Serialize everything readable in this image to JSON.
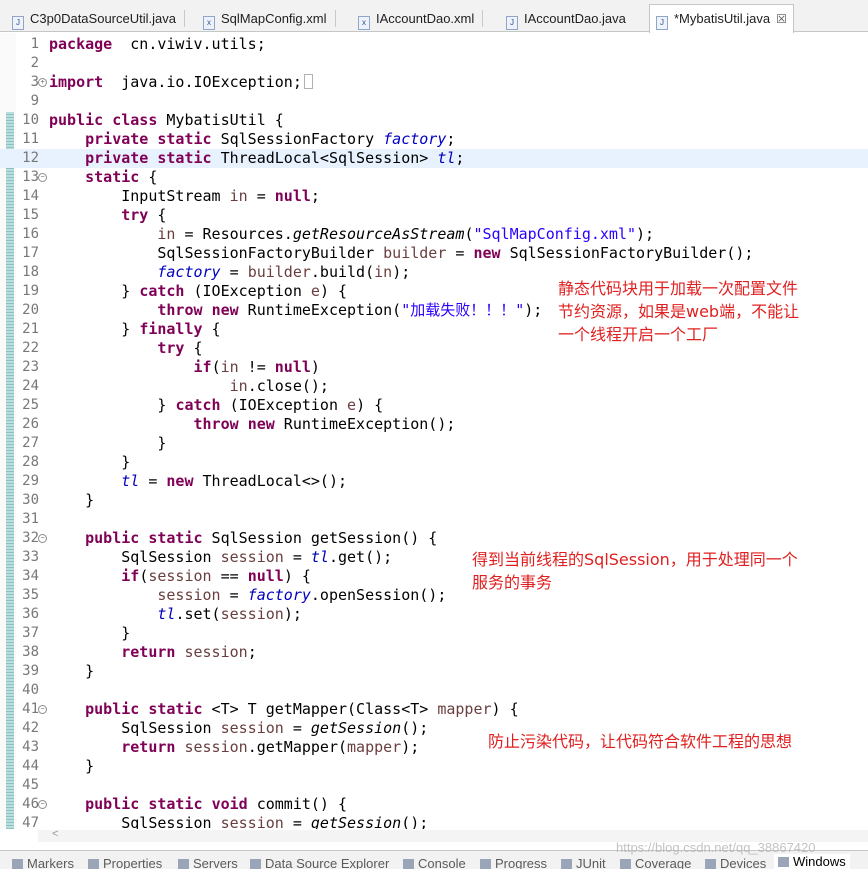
{
  "tabs": [
    {
      "label": "C3p0DataSourceUtil.java",
      "icon": "java-file-icon"
    },
    {
      "label": "SqlMapConfig.xml",
      "icon": "xml-file-icon"
    },
    {
      "label": "IAccountDao.xml",
      "icon": "xml-file-icon"
    },
    {
      "label": "IAccountDao.java",
      "icon": "java-file-icon"
    },
    {
      "label": "*MybatisUtil.java",
      "icon": "java-file-icon",
      "active": true,
      "close": "☒"
    }
  ],
  "editor": {
    "highlighted_line": 12,
    "lines": [
      {
        "n": "1",
        "t": [
          [
            "k",
            "package"
          ],
          [
            "",
            "  cn.viwiv.utils;"
          ]
        ]
      },
      {
        "n": "2",
        "t": []
      },
      {
        "n": "3",
        "fold": "plus",
        "t": [
          [
            "k",
            "import"
          ],
          [
            "",
            "  java.io.IOException;"
          ]
        ],
        "folded": true
      },
      {
        "n": "9",
        "t": []
      },
      {
        "n": "10",
        "t": [
          [
            "k",
            "public"
          ],
          [
            "",
            " "
          ],
          [
            "k",
            "class"
          ],
          [
            "",
            " MybatisUtil {"
          ]
        ]
      },
      {
        "n": "11",
        "t": [
          [
            "",
            "    "
          ],
          [
            "k",
            "private"
          ],
          [
            "",
            " "
          ],
          [
            "k",
            "static"
          ],
          [
            "",
            " SqlSessionFactory "
          ],
          [
            "fi",
            "factory"
          ],
          [
            "",
            ";"
          ]
        ]
      },
      {
        "n": "12",
        "t": [
          [
            "",
            "    "
          ],
          [
            "k",
            "private"
          ],
          [
            "",
            " "
          ],
          [
            "k",
            "static"
          ],
          [
            "",
            " ThreadLocal<SqlSession> "
          ],
          [
            "fi",
            "tl"
          ],
          [
            "",
            ";"
          ]
        ]
      },
      {
        "n": "13",
        "fold": "minus",
        "t": [
          [
            "",
            "    "
          ],
          [
            "k",
            "static"
          ],
          [
            "",
            " {"
          ]
        ]
      },
      {
        "n": "14",
        "t": [
          [
            "",
            "        InputStream "
          ],
          [
            "v",
            "in"
          ],
          [
            "",
            " = "
          ],
          [
            "k",
            "null"
          ],
          [
            "",
            ";"
          ]
        ]
      },
      {
        "n": "15",
        "t": [
          [
            "",
            "        "
          ],
          [
            "k",
            "try"
          ],
          [
            "",
            " {"
          ]
        ]
      },
      {
        "n": "16",
        "t": [
          [
            "",
            "            "
          ],
          [
            "v",
            "in"
          ],
          [
            "",
            " = Resources."
          ],
          [
            "mi",
            "getResourceAsStream"
          ],
          [
            "",
            "("
          ],
          [
            "s",
            "\"SqlMapConfig.xml\""
          ],
          [
            "",
            ");"
          ]
        ]
      },
      {
        "n": "17",
        "t": [
          [
            "",
            "            SqlSessionFactoryBuilder "
          ],
          [
            "v",
            "builder"
          ],
          [
            "",
            " = "
          ],
          [
            "k",
            "new"
          ],
          [
            "",
            " SqlSessionFactoryBuilder();"
          ]
        ]
      },
      {
        "n": "18",
        "t": [
          [
            "",
            "            "
          ],
          [
            "fi",
            "factory"
          ],
          [
            "",
            " = "
          ],
          [
            "v",
            "builder"
          ],
          [
            "",
            ".build("
          ],
          [
            "v",
            "in"
          ],
          [
            "",
            ");"
          ]
        ]
      },
      {
        "n": "19",
        "t": [
          [
            "",
            "        } "
          ],
          [
            "k",
            "catch"
          ],
          [
            "",
            " (IOException "
          ],
          [
            "v",
            "e"
          ],
          [
            "",
            ") {"
          ]
        ]
      },
      {
        "n": "20",
        "t": [
          [
            "",
            "            "
          ],
          [
            "k",
            "throw"
          ],
          [
            "",
            " "
          ],
          [
            "k",
            "new"
          ],
          [
            "",
            " RuntimeException("
          ],
          [
            "s",
            "\"加载失败！！！\""
          ],
          [
            "",
            ");"
          ]
        ]
      },
      {
        "n": "21",
        "t": [
          [
            "",
            "        } "
          ],
          [
            "k",
            "finally"
          ],
          [
            "",
            " {"
          ]
        ]
      },
      {
        "n": "22",
        "t": [
          [
            "",
            "            "
          ],
          [
            "k",
            "try"
          ],
          [
            "",
            " {"
          ]
        ]
      },
      {
        "n": "23",
        "t": [
          [
            "",
            "                "
          ],
          [
            "k",
            "if"
          ],
          [
            "",
            "("
          ],
          [
            "v",
            "in"
          ],
          [
            "",
            " != "
          ],
          [
            "k",
            "null"
          ],
          [
            "",
            ")"
          ]
        ]
      },
      {
        "n": "24",
        "t": [
          [
            "",
            "                    "
          ],
          [
            "v",
            "in"
          ],
          [
            "",
            ".close();"
          ]
        ]
      },
      {
        "n": "25",
        "t": [
          [
            "",
            "            } "
          ],
          [
            "k",
            "catch"
          ],
          [
            "",
            " (IOException "
          ],
          [
            "v",
            "e"
          ],
          [
            "",
            ") {"
          ]
        ]
      },
      {
        "n": "26",
        "t": [
          [
            "",
            "                "
          ],
          [
            "k",
            "throw"
          ],
          [
            "",
            " "
          ],
          [
            "k",
            "new"
          ],
          [
            "",
            " RuntimeException();"
          ]
        ]
      },
      {
        "n": "27",
        "t": [
          [
            "",
            "            }"
          ]
        ]
      },
      {
        "n": "28",
        "t": [
          [
            "",
            "        }"
          ]
        ]
      },
      {
        "n": "29",
        "t": [
          [
            "",
            "        "
          ],
          [
            "fi",
            "tl"
          ],
          [
            "",
            " = "
          ],
          [
            "k",
            "new"
          ],
          [
            "",
            " ThreadLocal<>();"
          ]
        ]
      },
      {
        "n": "30",
        "t": [
          [
            "",
            "    }"
          ]
        ]
      },
      {
        "n": "31",
        "t": []
      },
      {
        "n": "32",
        "fold": "minus",
        "t": [
          [
            "",
            "    "
          ],
          [
            "k",
            "public"
          ],
          [
            "",
            " "
          ],
          [
            "k",
            "static"
          ],
          [
            "",
            " SqlSession getSession() {"
          ]
        ]
      },
      {
        "n": "33",
        "t": [
          [
            "",
            "        SqlSession "
          ],
          [
            "v",
            "session"
          ],
          [
            "",
            " = "
          ],
          [
            "fi",
            "tl"
          ],
          [
            "",
            ".get();"
          ]
        ]
      },
      {
        "n": "34",
        "t": [
          [
            "",
            "        "
          ],
          [
            "k",
            "if"
          ],
          [
            "",
            "("
          ],
          [
            "v",
            "session"
          ],
          [
            "",
            " == "
          ],
          [
            "k",
            "null"
          ],
          [
            "",
            ") {"
          ]
        ]
      },
      {
        "n": "35",
        "t": [
          [
            "",
            "            "
          ],
          [
            "v",
            "session"
          ],
          [
            "",
            " = "
          ],
          [
            "fi",
            "factory"
          ],
          [
            "",
            ".openSession();"
          ]
        ]
      },
      {
        "n": "36",
        "t": [
          [
            "",
            "            "
          ],
          [
            "fi",
            "tl"
          ],
          [
            "",
            ".set("
          ],
          [
            "v",
            "session"
          ],
          [
            "",
            ");"
          ]
        ]
      },
      {
        "n": "37",
        "t": [
          [
            "",
            "        }"
          ]
        ]
      },
      {
        "n": "38",
        "t": [
          [
            "",
            "        "
          ],
          [
            "k",
            "return"
          ],
          [
            "",
            " "
          ],
          [
            "v",
            "session"
          ],
          [
            "",
            ";"
          ]
        ]
      },
      {
        "n": "39",
        "t": [
          [
            "",
            "    }"
          ]
        ]
      },
      {
        "n": "40",
        "t": []
      },
      {
        "n": "41",
        "fold": "minus",
        "t": [
          [
            "",
            "    "
          ],
          [
            "k",
            "public"
          ],
          [
            "",
            " "
          ],
          [
            "k",
            "static"
          ],
          [
            "",
            " <T> T getMapper(Class<T> "
          ],
          [
            "v",
            "mapper"
          ],
          [
            "",
            ") {"
          ]
        ]
      },
      {
        "n": "42",
        "t": [
          [
            "",
            "        SqlSession "
          ],
          [
            "v",
            "session"
          ],
          [
            "",
            " = "
          ],
          [
            "mi",
            "getSession"
          ],
          [
            "",
            "();"
          ]
        ]
      },
      {
        "n": "43",
        "t": [
          [
            "",
            "        "
          ],
          [
            "k",
            "return"
          ],
          [
            "",
            " "
          ],
          [
            "v",
            "session"
          ],
          [
            "",
            ".getMapper("
          ],
          [
            "v",
            "mapper"
          ],
          [
            "",
            ");"
          ]
        ]
      },
      {
        "n": "44",
        "t": [
          [
            "",
            "    }"
          ]
        ]
      },
      {
        "n": "45",
        "t": []
      },
      {
        "n": "46",
        "fold": "minus",
        "t": [
          [
            "",
            "    "
          ],
          [
            "k",
            "public"
          ],
          [
            "",
            " "
          ],
          [
            "k",
            "static"
          ],
          [
            "",
            " "
          ],
          [
            "k",
            "void"
          ],
          [
            "",
            " commit() {"
          ]
        ]
      },
      {
        "n": "47",
        "t": [
          [
            "",
            "        SqlSession "
          ],
          [
            "v",
            "session"
          ],
          [
            "",
            " = "
          ],
          [
            "mi",
            "getSession"
          ],
          [
            "",
            "();"
          ]
        ]
      }
    ]
  },
  "annotations": [
    {
      "text": "静态代码块用于加载一次配置文件\n节约资源，如果是web端，不能让\n一个线程开启一个工厂"
    },
    {
      "text": "得到当前线程的SqlSession，用于处理同一个\n服务的事务"
    },
    {
      "text": "防止污染代码，让代码符合软件工程的思想"
    }
  ],
  "bottom_tabs": [
    {
      "label": "Markers"
    },
    {
      "label": "Properties"
    },
    {
      "label": "Servers"
    },
    {
      "label": "Data Source Explorer"
    },
    {
      "label": "Console"
    },
    {
      "label": "Progress"
    },
    {
      "label": "JUnit"
    },
    {
      "label": "Coverage"
    },
    {
      "label": "Devices"
    },
    {
      "label": "Windows",
      "active": true
    }
  ],
  "watermark": "https://blog.csdn.net/qq_38867420",
  "colors": {
    "keyword": "#7f0055",
    "field": "#0000c0",
    "string": "#2a00ff",
    "local": "#6a3e3e",
    "annotation": "#e02020",
    "current_line": "#e8f2fe"
  }
}
